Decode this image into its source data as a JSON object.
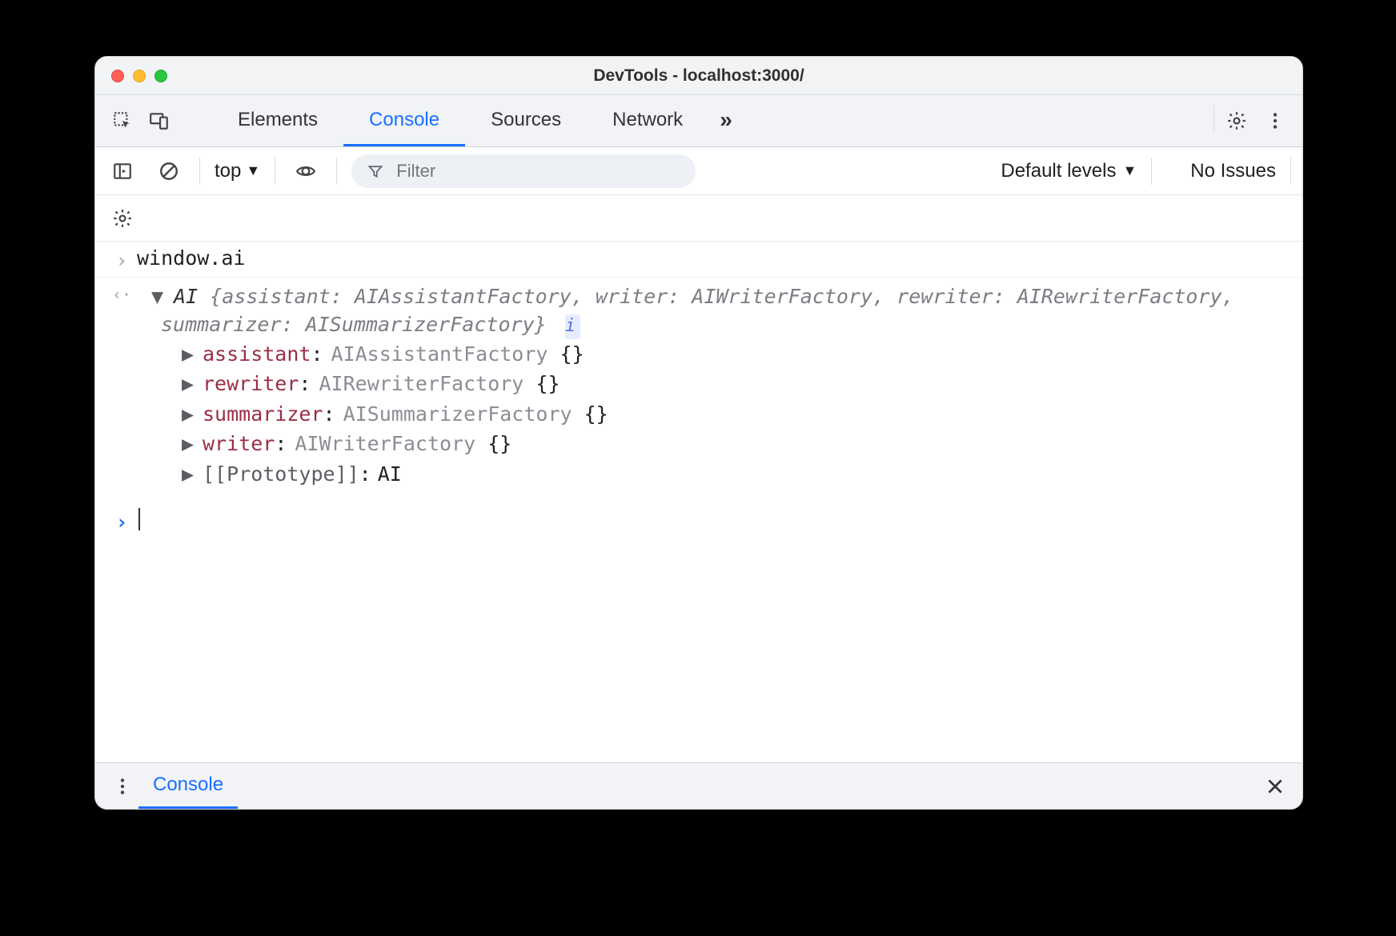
{
  "window": {
    "title": "DevTools - localhost:3000/"
  },
  "tabs": {
    "elements": "Elements",
    "console": "Console",
    "sources": "Sources",
    "network": "Network",
    "active": "console"
  },
  "consoleToolbar": {
    "context": "top",
    "filter_placeholder": "Filter",
    "levels_label": "Default levels",
    "issues_label": "No Issues"
  },
  "console": {
    "input": "window.ai",
    "result": {
      "class": "AI",
      "summary_segments": {
        "open": "{",
        "k1": "assistant:",
        "v1": "AIAssistantFactory",
        "c1": ", ",
        "k2": "writer:",
        "v2": "AIWriterFactory",
        "c2": ", ",
        "k3": "rewriter:",
        "v3": "AIRewriterFactory",
        "c3": ", ",
        "k4": "summarizer:",
        "v4": "AISummarizerFactory",
        "close": "}"
      },
      "info_badge": "i",
      "props": [
        {
          "key": "assistant",
          "val": "AIAssistantFactory",
          "braces": "{}"
        },
        {
          "key": "rewriter",
          "val": "AIRewriterFactory",
          "braces": "{}"
        },
        {
          "key": "summarizer",
          "val": "AISummarizerFactory",
          "braces": "{}"
        },
        {
          "key": "writer",
          "val": "AIWriterFactory",
          "braces": "{}"
        }
      ],
      "proto": {
        "key": "[[Prototype]]",
        "val": "AI"
      }
    }
  },
  "drawer": {
    "tab": "Console"
  }
}
